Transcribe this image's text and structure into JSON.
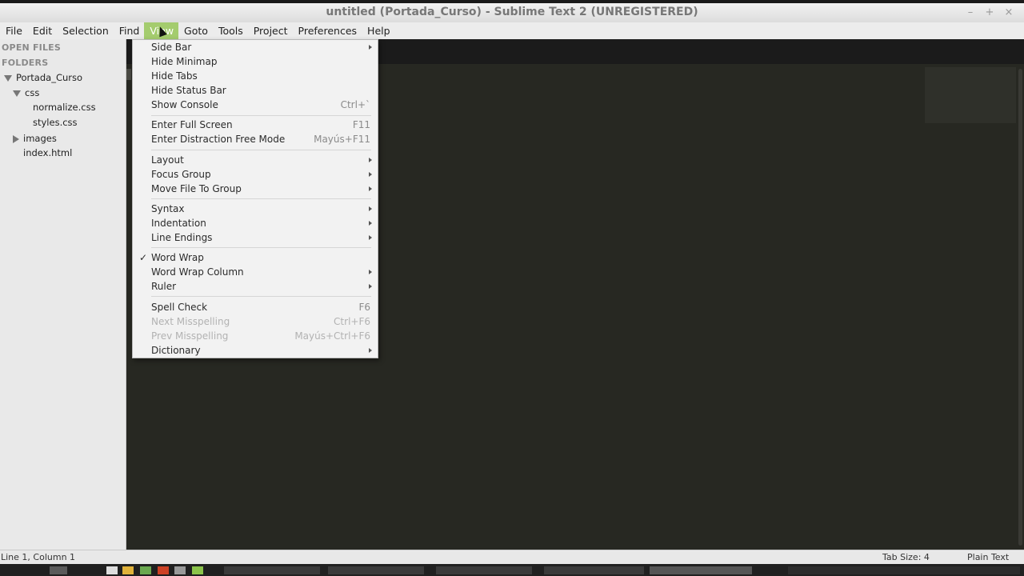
{
  "window": {
    "title": "untitled (Portada_Curso) - Sublime Text 2 (UNREGISTERED)",
    "controls": [
      "–",
      "+",
      "×"
    ]
  },
  "menubar": [
    "File",
    "Edit",
    "Selection",
    "Find",
    "View",
    "Goto",
    "Tools",
    "Project",
    "Preferences",
    "Help"
  ],
  "sidebar": {
    "open_files": "OPEN FILES",
    "folders": "FOLDERS",
    "tree": {
      "root": "Portada_Curso",
      "css": "css",
      "normalize": "normalize.css",
      "styles": "styles.css",
      "images": "images",
      "index": "index.html"
    }
  },
  "view_menu": [
    {
      "label": "Side Bar",
      "submenu": true
    },
    {
      "label": "Hide Minimap"
    },
    {
      "label": "Hide Tabs"
    },
    {
      "label": "Hide Status Bar"
    },
    {
      "label": "Show Console",
      "shortcut": "Ctrl+`"
    },
    {
      "label": "Enter Full Screen",
      "shortcut": "F11"
    },
    {
      "label": "Enter Distraction Free Mode",
      "shortcut": "Mayús+F11"
    },
    {
      "label": "Layout",
      "submenu": true
    },
    {
      "label": "Focus Group",
      "submenu": true
    },
    {
      "label": "Move File To Group",
      "submenu": true
    },
    {
      "label": "Syntax",
      "submenu": true
    },
    {
      "label": "Indentation",
      "submenu": true
    },
    {
      "label": "Line Endings",
      "submenu": true
    },
    {
      "label": "Word Wrap",
      "checked": true
    },
    {
      "label": "Word Wrap Column",
      "submenu": true
    },
    {
      "label": "Ruler",
      "submenu": true
    },
    {
      "label": "Spell Check",
      "shortcut": "F6"
    },
    {
      "label": "Next Misspelling",
      "shortcut": "Ctrl+F6",
      "disabled": true
    },
    {
      "label": "Prev Misspelling",
      "shortcut": "Mayús+Ctrl+F6",
      "disabled": true
    },
    {
      "label": "Dictionary",
      "submenu": true
    }
  ],
  "statusbar": {
    "position": "Line 1, Column 1",
    "tab_size": "Tab Size: 4",
    "syntax": "Plain Text"
  },
  "colors": {
    "menu_active": "#a4cc6e",
    "editor_bg": "#272822",
    "sidebar_bg": "#e9e9e9"
  }
}
